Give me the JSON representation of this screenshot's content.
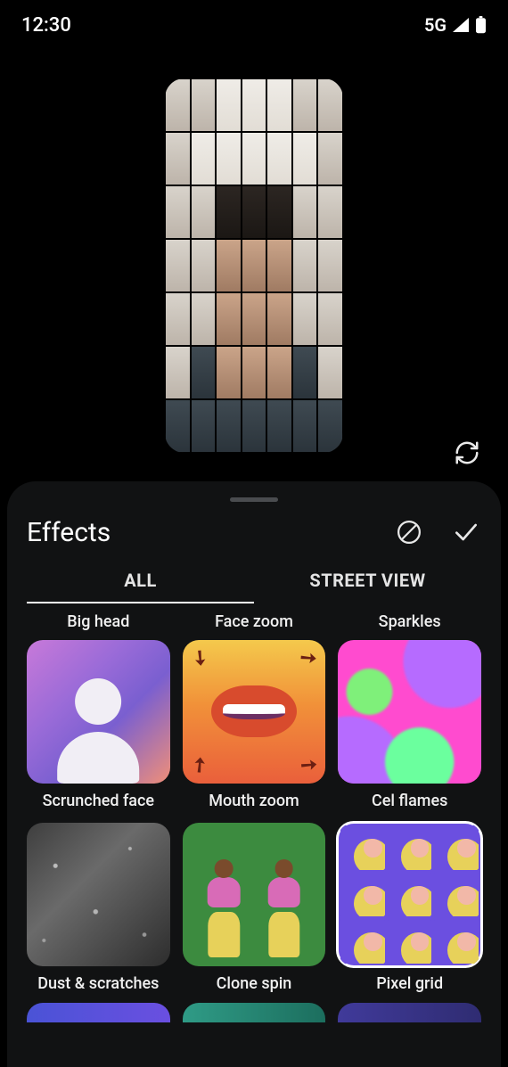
{
  "status_bar": {
    "time": "12:30",
    "network": "5G"
  },
  "preview": {
    "cycle_icon": "cycle-icon"
  },
  "sheet": {
    "title": "Effects",
    "clear_icon": "no-symbol-icon",
    "confirm_icon": "check-icon"
  },
  "tabs": {
    "active_index": 0,
    "items": [
      "ALL",
      "STREET VIEW"
    ]
  },
  "effects": {
    "peek_row_labels": [
      "Big head",
      "Face zoom",
      "Sparkles"
    ],
    "items": [
      {
        "id": "scrunched-face",
        "label": "Scrunched face",
        "selected": false
      },
      {
        "id": "mouth-zoom",
        "label": "Mouth zoom",
        "selected": false
      },
      {
        "id": "cel-flames",
        "label": "Cel flames",
        "selected": false
      },
      {
        "id": "dust-scratches",
        "label": "Dust & scratches",
        "selected": false
      },
      {
        "id": "clone-spin",
        "label": "Clone spin",
        "selected": false
      },
      {
        "id": "pixel-grid",
        "label": "Pixel grid",
        "selected": true
      }
    ]
  }
}
